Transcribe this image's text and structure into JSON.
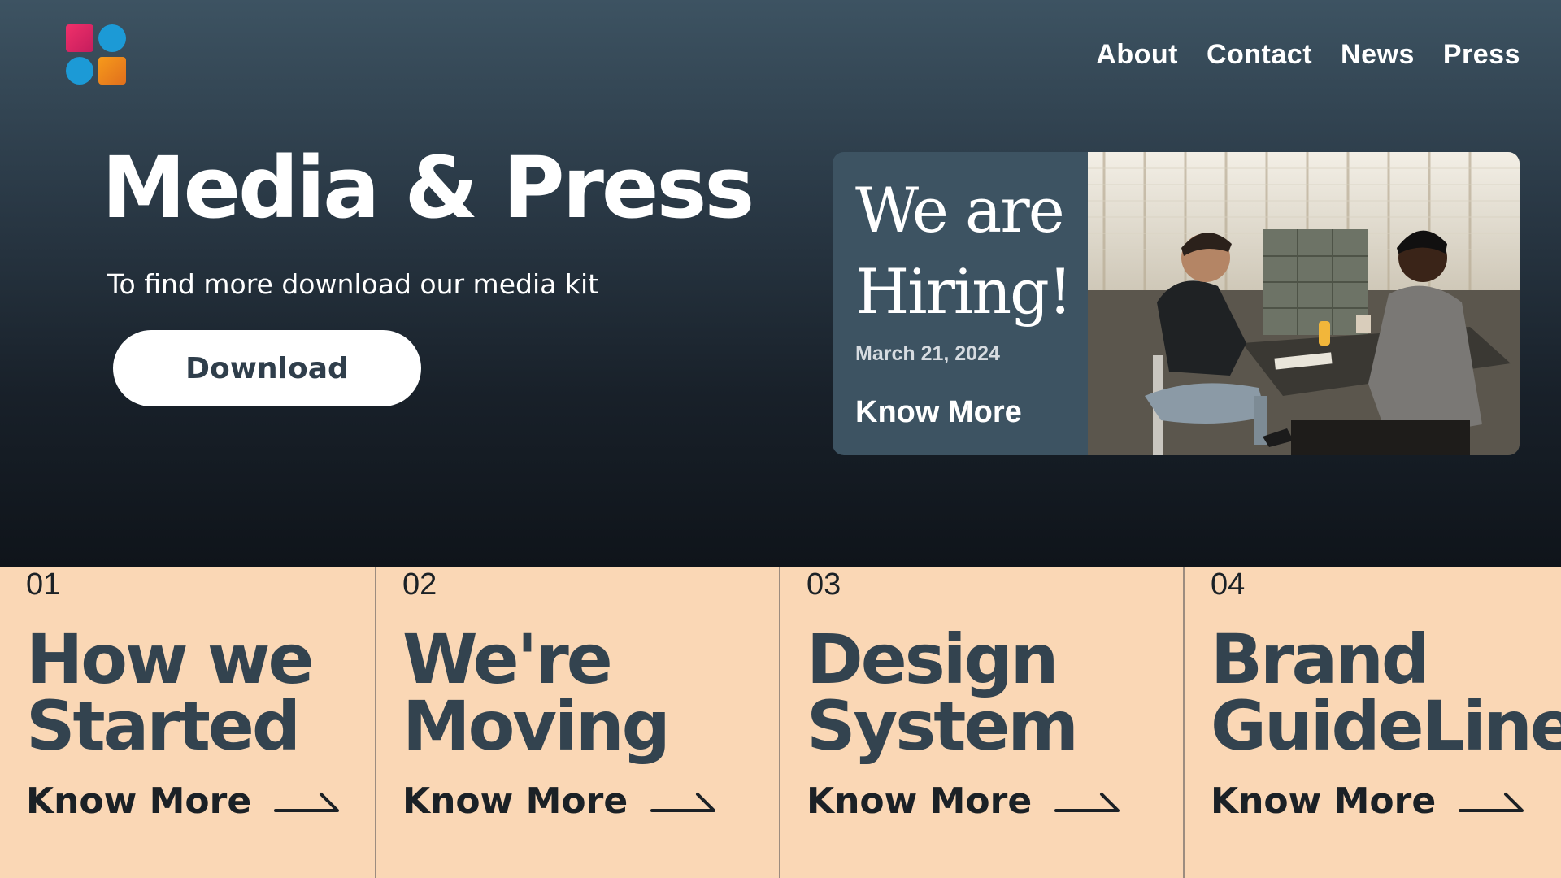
{
  "nav": {
    "items": [
      "About",
      "Contact",
      "News",
      "Press"
    ]
  },
  "hero": {
    "title": "Media & Press",
    "subtitle": "To find more download our media kit",
    "download_label": "Download"
  },
  "hiring": {
    "title_line1": "We are",
    "title_line2": "Hiring!",
    "date": "March 21, 2024",
    "more_label": "Know More"
  },
  "cards": [
    {
      "number": "01",
      "title_line1": "How we",
      "title_line2": "Started",
      "more_label": "Know More"
    },
    {
      "number": "02",
      "title_line1": "We're",
      "title_line2": "Moving",
      "more_label": "Know More"
    },
    {
      "number": "03",
      "title_line1": "Design",
      "title_line2": "System",
      "more_label": "Know More"
    },
    {
      "number": "04",
      "title_line1": "Brand",
      "title_line2": "GuideLine",
      "more_label": "Know More"
    }
  ],
  "colors": {
    "hero_top": "#3d5362",
    "hero_bottom": "#0f141a",
    "cards_bg": "#fad7b5",
    "card_title": "#33434f",
    "logo_pink": "#e0245e",
    "logo_blue": "#1c9ad6",
    "logo_orange": "#f08a1b"
  }
}
